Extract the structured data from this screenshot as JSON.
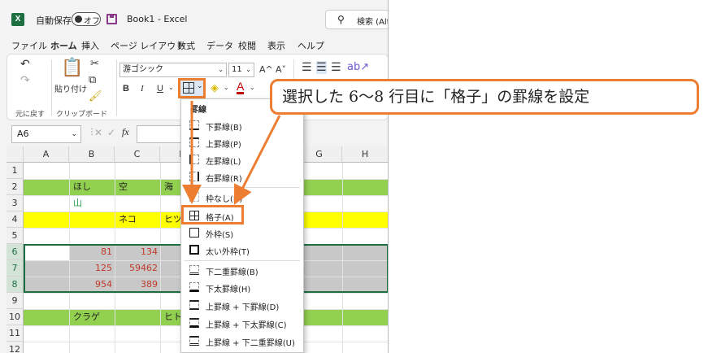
{
  "titlebar": {
    "autosave_label": "自動保存",
    "autosave_state": "オフ",
    "title": "Book1 - Excel",
    "search_placeholder": "検索 (Alt"
  },
  "menu": [
    "ファイル",
    "ホーム",
    "挿入",
    "ページ レイアウト",
    "数式",
    "データ",
    "校閲",
    "表示",
    "ヘルプ"
  ],
  "ribbon": {
    "undo_group_label": "元に戻す",
    "paste_label": "貼り付け",
    "clipboard_group_label": "クリップボード",
    "font_name": "游ゴシック",
    "font_size": "11",
    "bold": "B",
    "italic": "I",
    "underline": "U",
    "grow_font": "A^",
    "shrink_font": "A˅",
    "font_color_glyph": "A"
  },
  "formula_bar": {
    "name_box": "A6",
    "fx": "fx"
  },
  "columns": [
    "A",
    "B",
    "C",
    "D",
    "E",
    "F",
    "G",
    "H"
  ],
  "rows": [
    "1",
    "2",
    "3",
    "4",
    "5",
    "6",
    "7",
    "8",
    "9",
    "10",
    "11",
    "12"
  ],
  "cells": {
    "b2": "ほし",
    "c2": "空",
    "d2": "海",
    "b3": "山",
    "c4": "ネコ",
    "d4": "ヒツ",
    "b6": "81",
    "c6": "134",
    "b7": "125",
    "c7": "59462",
    "b8": "954",
    "c8": "389",
    "b10": "クラゲ",
    "d10": "ヒト"
  },
  "colors": {
    "green_row": "#92d050",
    "yellow_row": "#ffff00",
    "selection_gray": "#c8c8c8",
    "accent_orange": "#ed7d31",
    "excel_green": "#1d6f42"
  },
  "border_menu": {
    "heading": "罫線",
    "items": [
      "下罫線(B)",
      "上罫線(P)",
      "左罫線(L)",
      "右罫線(R)",
      "枠なし(N)",
      "格子(A)",
      "外枠(S)",
      "太い外枠(T)",
      "下二重罫線(B)",
      "下太罫線(H)",
      "上罫線 + 下罫線(D)",
      "上罫線 + 下太罫線(C)",
      "上罫線 + 下二重罫線(U)"
    ]
  },
  "callout": "選択した 6〜8 行目に「格子」の罫線を設定"
}
